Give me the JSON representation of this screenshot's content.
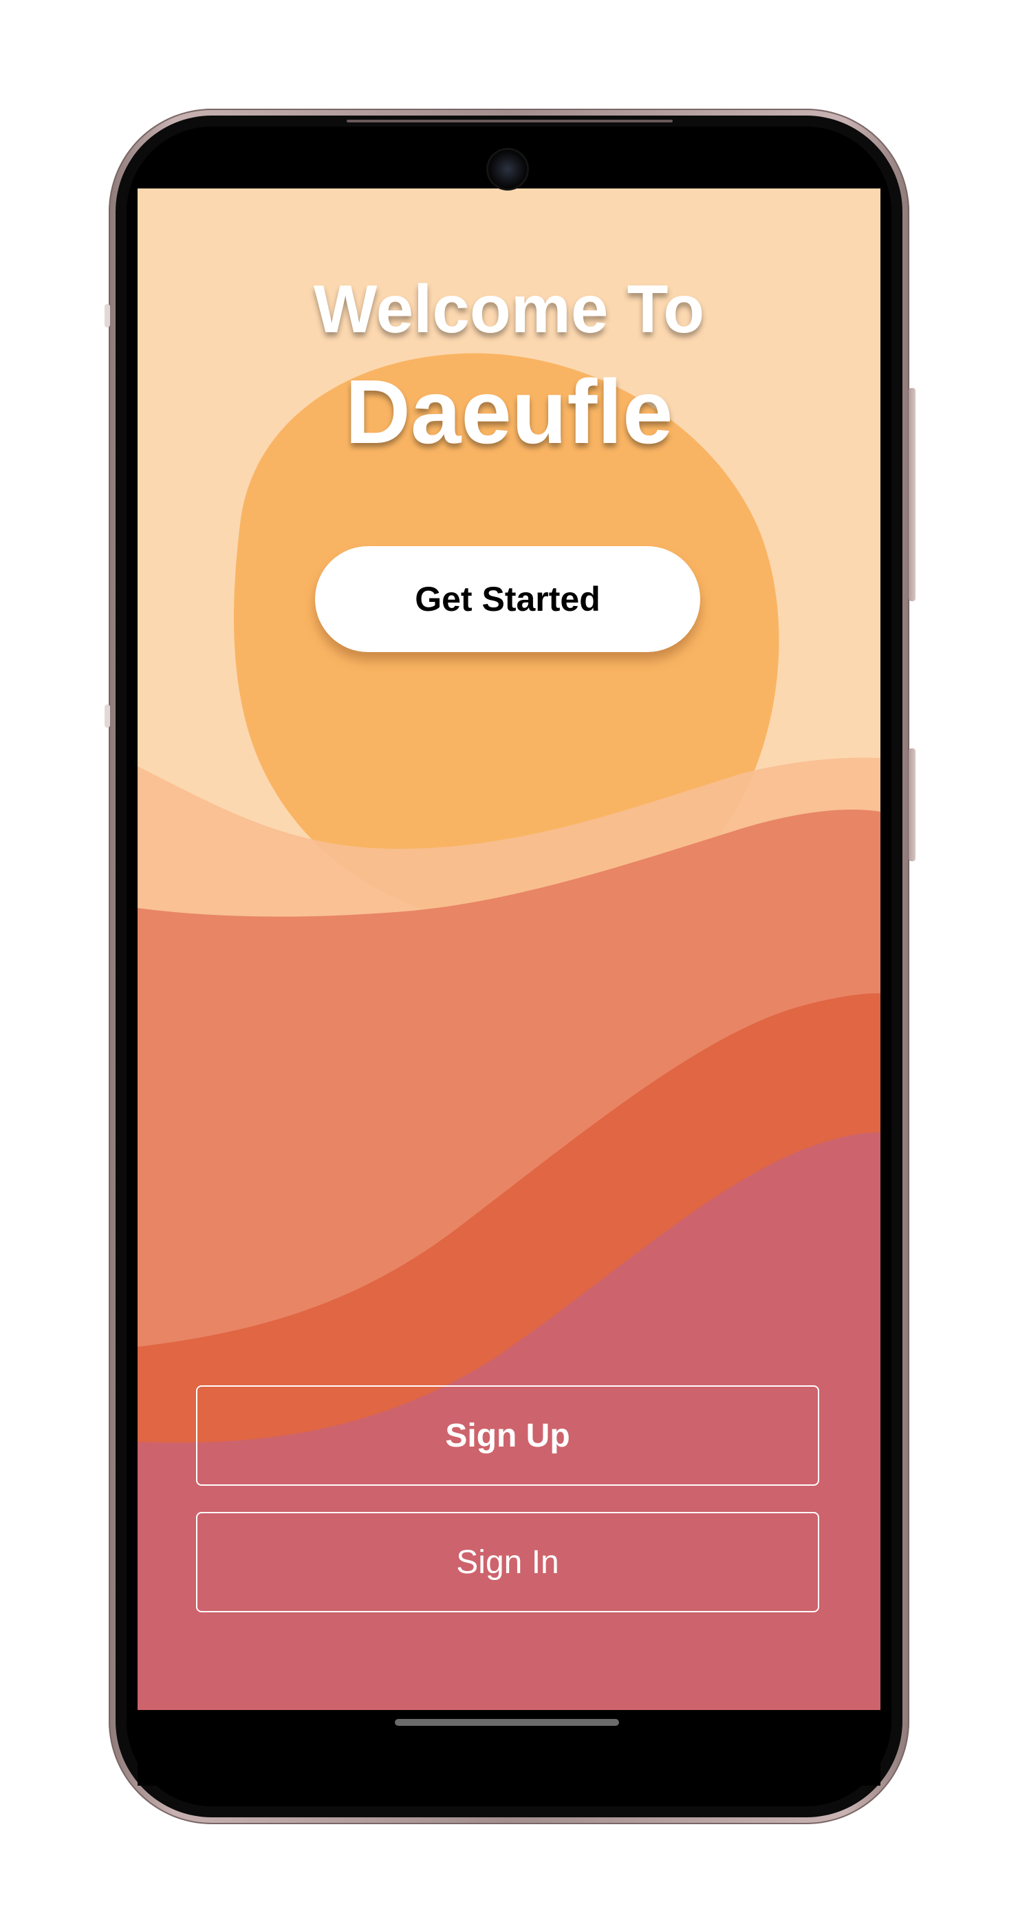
{
  "device": {
    "frame_color": "#a38e8e",
    "screen_background": "#fcd8b0"
  },
  "welcome": {
    "line1": "Welcome To",
    "app_name": "Daeufle"
  },
  "actions": {
    "get_started_label": "Get Started",
    "sign_up_label": "Sign Up",
    "sign_in_label": "Sign In"
  },
  "theme": {
    "sky": "#fcd8b0",
    "sun": "#f9b463",
    "dune_light": "#f8bf91",
    "dune_mid": "#e88565",
    "dune_dark": "#e06644",
    "dune_rose": "#cd636c"
  }
}
